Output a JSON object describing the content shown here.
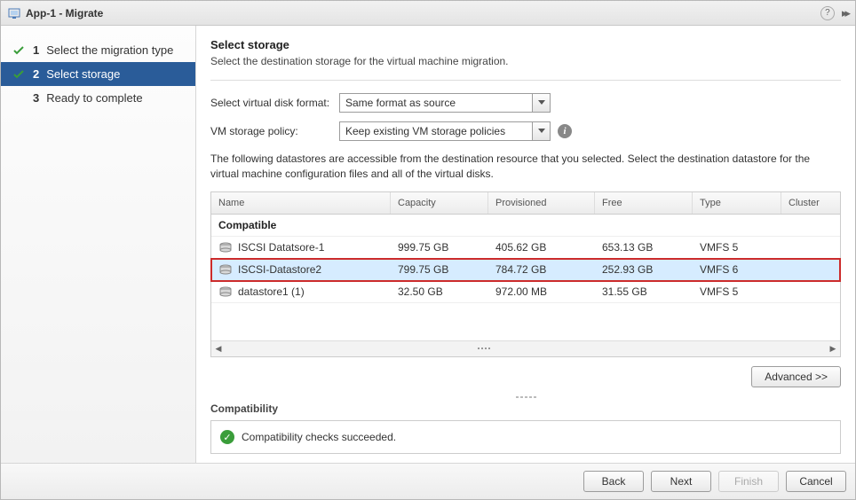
{
  "titlebar": {
    "title": "App-1 - Migrate"
  },
  "steps": [
    {
      "num": "1",
      "label": "Select the migration type",
      "done": true,
      "active": false
    },
    {
      "num": "2",
      "label": "Select storage",
      "done": true,
      "active": true
    },
    {
      "num": "3",
      "label": "Ready to complete",
      "done": false,
      "active": false
    }
  ],
  "header": {
    "title": "Select storage",
    "subtitle": "Select the destination storage for the virtual machine migration."
  },
  "form": {
    "disk_format_label": "Select virtual disk format:",
    "disk_format_value": "Same format as source",
    "policy_label": "VM storage policy:",
    "policy_value": "Keep existing VM storage policies"
  },
  "description": "The following datastores are accessible from the destination resource that you selected. Select the destination datastore for the virtual machine configuration files and all of the virtual disks.",
  "table": {
    "headers": {
      "name": "Name",
      "capacity": "Capacity",
      "provisioned": "Provisioned",
      "free": "Free",
      "type": "Type",
      "cluster": "Cluster"
    },
    "group": "Compatible",
    "rows": [
      {
        "name": "ISCSI Datatsore-1",
        "capacity": "999.75 GB",
        "provisioned": "405.62 GB",
        "free": "653.13 GB",
        "type": "VMFS 5",
        "cluster": "",
        "selected": false,
        "highlighted": false
      },
      {
        "name": "ISCSI-Datastore2",
        "capacity": "799.75 GB",
        "provisioned": "784.72 GB",
        "free": "252.93 GB",
        "type": "VMFS 6",
        "cluster": "",
        "selected": true,
        "highlighted": true
      },
      {
        "name": "datastore1 (1)",
        "capacity": "32.50 GB",
        "provisioned": "972.00 MB",
        "free": "31.55 GB",
        "type": "VMFS 5",
        "cluster": "",
        "selected": false,
        "highlighted": false
      }
    ]
  },
  "buttons": {
    "advanced": "Advanced >>",
    "back": "Back",
    "next": "Next",
    "finish": "Finish",
    "cancel": "Cancel"
  },
  "compatibility": {
    "title": "Compatibility",
    "message": "Compatibility checks succeeded."
  }
}
